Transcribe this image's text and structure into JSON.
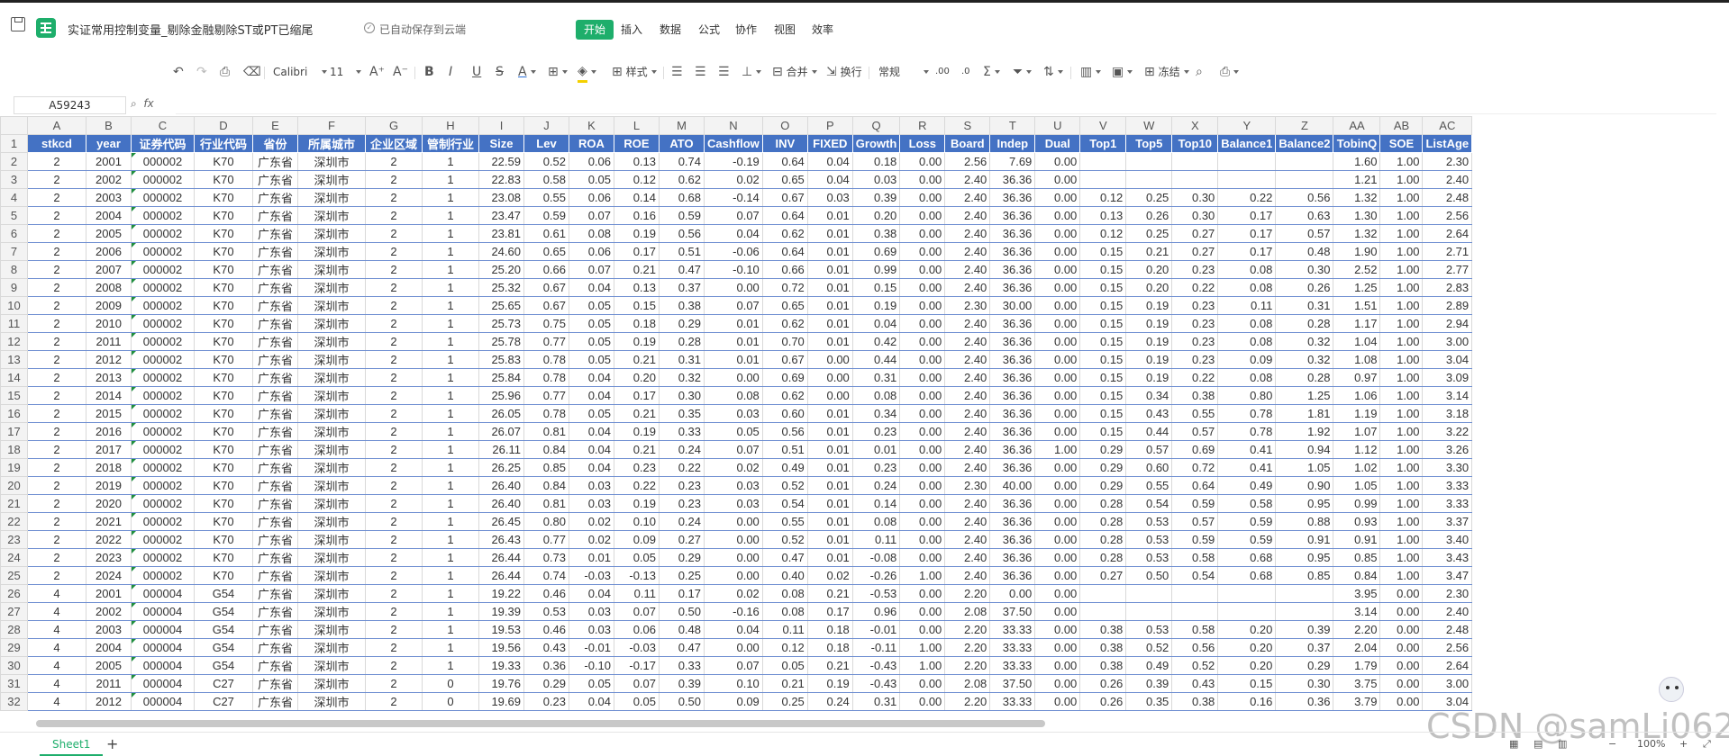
{
  "app": {
    "title": "实证常用控制变量_剔除金融剔除ST或PT已缩尾",
    "cloud_status": "已自动保存到云端"
  },
  "menu": {
    "tabs": [
      {
        "label": "开始",
        "active": true
      },
      {
        "label": "插入",
        "active": false
      },
      {
        "label": "数据",
        "active": false
      },
      {
        "label": "公式",
        "active": false
      },
      {
        "label": "协作",
        "active": false
      },
      {
        "label": "视图",
        "active": false
      },
      {
        "label": "效率",
        "active": false
      }
    ]
  },
  "toolbar": {
    "font_name": "Calibri",
    "font_size": "11",
    "styles_label": "样式",
    "merge_label": "合并",
    "wrap_label": "换行",
    "number_format": "常规",
    "freeze_label": "冻结",
    "bold": "B",
    "italic": "I",
    "underline": "U",
    "strike": "S",
    "font_color_glyph": "A",
    "inc_font": "A⁺",
    "dec_font": "A⁻",
    "dec_inc": ".00",
    "dec_dec": ".0",
    "sum_glyph": "Σ"
  },
  "formula_bar": {
    "cell_ref": "A59243",
    "fx_label": "fx",
    "formula_value": ""
  },
  "sheet": {
    "columns": [
      "A",
      "B",
      "C",
      "D",
      "E",
      "F",
      "G",
      "H",
      "I",
      "J",
      "K",
      "L",
      "M",
      "N",
      "O",
      "P",
      "Q",
      "R",
      "S",
      "T",
      "U",
      "V",
      "W",
      "X",
      "Y",
      "Z",
      "AA",
      "AB",
      "AC"
    ],
    "header_row": [
      "stkcd",
      "year",
      "证券代码",
      "行业代码",
      "省份",
      "所属城市",
      "企业区域",
      "管制行业",
      "Size",
      "Lev",
      "ROA",
      "ROE",
      "ATO",
      "Cashflow",
      "INV",
      "FIXED",
      "Growth",
      "Loss",
      "Board",
      "Indep",
      "Dual",
      "Top1",
      "Top5",
      "Top10",
      "Balance1",
      "Balance2",
      "TobinQ",
      "SOE",
      "ListAge"
    ],
    "rows": [
      [
        "2",
        "2001",
        "000002",
        "K70",
        "广东省",
        "深圳市",
        "2",
        "1",
        "22.59",
        "0.52",
        "0.06",
        "0.13",
        "0.74",
        "-0.19",
        "0.64",
        "0.04",
        "0.18",
        "0.00",
        "2.56",
        "7.69",
        "0.00",
        "",
        "",
        "",
        "",
        "",
        "1.60",
        "1.00",
        "2.30"
      ],
      [
        "2",
        "2002",
        "000002",
        "K70",
        "广东省",
        "深圳市",
        "2",
        "1",
        "22.83",
        "0.58",
        "0.05",
        "0.12",
        "0.62",
        "0.02",
        "0.65",
        "0.04",
        "0.03",
        "0.00",
        "2.40",
        "36.36",
        "0.00",
        "",
        "",
        "",
        "",
        "",
        "1.21",
        "1.00",
        "2.40"
      ],
      [
        "2",
        "2003",
        "000002",
        "K70",
        "广东省",
        "深圳市",
        "2",
        "1",
        "23.08",
        "0.55",
        "0.06",
        "0.14",
        "0.68",
        "-0.14",
        "0.67",
        "0.03",
        "0.39",
        "0.00",
        "2.40",
        "36.36",
        "0.00",
        "0.12",
        "0.25",
        "0.30",
        "0.22",
        "0.56",
        "1.32",
        "1.00",
        "2.48"
      ],
      [
        "2",
        "2004",
        "000002",
        "K70",
        "广东省",
        "深圳市",
        "2",
        "1",
        "23.47",
        "0.59",
        "0.07",
        "0.16",
        "0.59",
        "0.07",
        "0.64",
        "0.01",
        "0.20",
        "0.00",
        "2.40",
        "36.36",
        "0.00",
        "0.13",
        "0.26",
        "0.30",
        "0.17",
        "0.63",
        "1.30",
        "1.00",
        "2.56"
      ],
      [
        "2",
        "2005",
        "000002",
        "K70",
        "广东省",
        "深圳市",
        "2",
        "1",
        "23.81",
        "0.61",
        "0.08",
        "0.19",
        "0.56",
        "0.04",
        "0.62",
        "0.01",
        "0.38",
        "0.00",
        "2.40",
        "36.36",
        "0.00",
        "0.12",
        "0.25",
        "0.27",
        "0.17",
        "0.57",
        "1.32",
        "1.00",
        "2.64"
      ],
      [
        "2",
        "2006",
        "000002",
        "K70",
        "广东省",
        "深圳市",
        "2",
        "1",
        "24.60",
        "0.65",
        "0.06",
        "0.17",
        "0.51",
        "-0.06",
        "0.64",
        "0.01",
        "0.69",
        "0.00",
        "2.40",
        "36.36",
        "0.00",
        "0.15",
        "0.21",
        "0.27",
        "0.17",
        "0.48",
        "1.90",
        "1.00",
        "2.71"
      ],
      [
        "2",
        "2007",
        "000002",
        "K70",
        "广东省",
        "深圳市",
        "2",
        "1",
        "25.20",
        "0.66",
        "0.07",
        "0.21",
        "0.47",
        "-0.10",
        "0.66",
        "0.01",
        "0.99",
        "0.00",
        "2.40",
        "36.36",
        "0.00",
        "0.15",
        "0.20",
        "0.23",
        "0.08",
        "0.30",
        "2.52",
        "1.00",
        "2.77"
      ],
      [
        "2",
        "2008",
        "000002",
        "K70",
        "广东省",
        "深圳市",
        "2",
        "1",
        "25.32",
        "0.67",
        "0.04",
        "0.13",
        "0.37",
        "0.00",
        "0.72",
        "0.01",
        "0.15",
        "0.00",
        "2.40",
        "36.36",
        "0.00",
        "0.15",
        "0.20",
        "0.22",
        "0.08",
        "0.26",
        "1.25",
        "1.00",
        "2.83"
      ],
      [
        "2",
        "2009",
        "000002",
        "K70",
        "广东省",
        "深圳市",
        "2",
        "1",
        "25.65",
        "0.67",
        "0.05",
        "0.15",
        "0.38",
        "0.07",
        "0.65",
        "0.01",
        "0.19",
        "0.00",
        "2.30",
        "30.00",
        "0.00",
        "0.15",
        "0.19",
        "0.23",
        "0.11",
        "0.31",
        "1.51",
        "1.00",
        "2.89"
      ],
      [
        "2",
        "2010",
        "000002",
        "K70",
        "广东省",
        "深圳市",
        "2",
        "1",
        "25.73",
        "0.75",
        "0.05",
        "0.18",
        "0.29",
        "0.01",
        "0.62",
        "0.01",
        "0.04",
        "0.00",
        "2.40",
        "36.36",
        "0.00",
        "0.15",
        "0.19",
        "0.23",
        "0.08",
        "0.28",
        "1.17",
        "1.00",
        "2.94"
      ],
      [
        "2",
        "2011",
        "000002",
        "K70",
        "广东省",
        "深圳市",
        "2",
        "1",
        "25.78",
        "0.77",
        "0.05",
        "0.19",
        "0.28",
        "0.01",
        "0.70",
        "0.01",
        "0.42",
        "0.00",
        "2.40",
        "36.36",
        "0.00",
        "0.15",
        "0.19",
        "0.23",
        "0.08",
        "0.32",
        "1.04",
        "1.00",
        "3.00"
      ],
      [
        "2",
        "2012",
        "000002",
        "K70",
        "广东省",
        "深圳市",
        "2",
        "1",
        "25.83",
        "0.78",
        "0.05",
        "0.21",
        "0.31",
        "0.01",
        "0.67",
        "0.00",
        "0.44",
        "0.00",
        "2.40",
        "36.36",
        "0.00",
        "0.15",
        "0.19",
        "0.23",
        "0.09",
        "0.32",
        "1.08",
        "1.00",
        "3.04"
      ],
      [
        "2",
        "2013",
        "000002",
        "K70",
        "广东省",
        "深圳市",
        "2",
        "1",
        "25.84",
        "0.78",
        "0.04",
        "0.20",
        "0.32",
        "0.00",
        "0.69",
        "0.00",
        "0.31",
        "0.00",
        "2.40",
        "36.36",
        "0.00",
        "0.15",
        "0.19",
        "0.22",
        "0.08",
        "0.28",
        "0.97",
        "1.00",
        "3.09"
      ],
      [
        "2",
        "2014",
        "000002",
        "K70",
        "广东省",
        "深圳市",
        "2",
        "1",
        "25.96",
        "0.77",
        "0.04",
        "0.17",
        "0.30",
        "0.08",
        "0.62",
        "0.00",
        "0.08",
        "0.00",
        "2.40",
        "36.36",
        "0.00",
        "0.15",
        "0.34",
        "0.38",
        "0.80",
        "1.25",
        "1.06",
        "1.00",
        "3.14"
      ],
      [
        "2",
        "2015",
        "000002",
        "K70",
        "广东省",
        "深圳市",
        "2",
        "1",
        "26.05",
        "0.78",
        "0.05",
        "0.21",
        "0.35",
        "0.03",
        "0.60",
        "0.01",
        "0.34",
        "0.00",
        "2.40",
        "36.36",
        "0.00",
        "0.15",
        "0.43",
        "0.55",
        "0.78",
        "1.81",
        "1.19",
        "1.00",
        "3.18"
      ],
      [
        "2",
        "2016",
        "000002",
        "K70",
        "广东省",
        "深圳市",
        "2",
        "1",
        "26.07",
        "0.81",
        "0.04",
        "0.19",
        "0.33",
        "0.05",
        "0.56",
        "0.01",
        "0.23",
        "0.00",
        "2.40",
        "36.36",
        "0.00",
        "0.15",
        "0.44",
        "0.57",
        "0.78",
        "1.92",
        "1.07",
        "1.00",
        "3.22"
      ],
      [
        "2",
        "2017",
        "000002",
        "K70",
        "广东省",
        "深圳市",
        "2",
        "1",
        "26.11",
        "0.84",
        "0.04",
        "0.21",
        "0.24",
        "0.07",
        "0.51",
        "0.01",
        "0.01",
        "0.00",
        "2.40",
        "36.36",
        "1.00",
        "0.29",
        "0.57",
        "0.69",
        "0.41",
        "0.94",
        "1.12",
        "1.00",
        "3.26"
      ],
      [
        "2",
        "2018",
        "000002",
        "K70",
        "广东省",
        "深圳市",
        "2",
        "1",
        "26.25",
        "0.85",
        "0.04",
        "0.23",
        "0.22",
        "0.02",
        "0.49",
        "0.01",
        "0.23",
        "0.00",
        "2.40",
        "36.36",
        "0.00",
        "0.29",
        "0.60",
        "0.72",
        "0.41",
        "1.05",
        "1.02",
        "1.00",
        "3.30"
      ],
      [
        "2",
        "2019",
        "000002",
        "K70",
        "广东省",
        "深圳市",
        "2",
        "1",
        "26.40",
        "0.84",
        "0.03",
        "0.22",
        "0.23",
        "0.03",
        "0.52",
        "0.01",
        "0.24",
        "0.00",
        "2.30",
        "40.00",
        "0.00",
        "0.29",
        "0.55",
        "0.64",
        "0.49",
        "0.90",
        "1.05",
        "1.00",
        "3.33"
      ],
      [
        "2",
        "2020",
        "000002",
        "K70",
        "广东省",
        "深圳市",
        "2",
        "1",
        "26.40",
        "0.81",
        "0.03",
        "0.19",
        "0.23",
        "0.03",
        "0.54",
        "0.01",
        "0.14",
        "0.00",
        "2.40",
        "36.36",
        "0.00",
        "0.28",
        "0.54",
        "0.59",
        "0.58",
        "0.95",
        "0.99",
        "1.00",
        "3.33"
      ],
      [
        "2",
        "2021",
        "000002",
        "K70",
        "广东省",
        "深圳市",
        "2",
        "1",
        "26.45",
        "0.80",
        "0.02",
        "0.10",
        "0.24",
        "0.00",
        "0.55",
        "0.01",
        "0.08",
        "0.00",
        "2.40",
        "36.36",
        "0.00",
        "0.28",
        "0.53",
        "0.57",
        "0.59",
        "0.88",
        "0.93",
        "1.00",
        "3.37"
      ],
      [
        "2",
        "2022",
        "000002",
        "K70",
        "广东省",
        "深圳市",
        "2",
        "1",
        "26.43",
        "0.77",
        "0.02",
        "0.09",
        "0.27",
        "0.00",
        "0.52",
        "0.01",
        "0.11",
        "0.00",
        "2.40",
        "36.36",
        "0.00",
        "0.28",
        "0.53",
        "0.59",
        "0.59",
        "0.91",
        "0.91",
        "1.00",
        "3.40"
      ],
      [
        "2",
        "2023",
        "000002",
        "K70",
        "广东省",
        "深圳市",
        "2",
        "1",
        "26.44",
        "0.73",
        "0.01",
        "0.05",
        "0.29",
        "0.00",
        "0.47",
        "0.01",
        "-0.08",
        "0.00",
        "2.40",
        "36.36",
        "0.00",
        "0.28",
        "0.53",
        "0.58",
        "0.68",
        "0.95",
        "0.85",
        "1.00",
        "3.43"
      ],
      [
        "2",
        "2024",
        "000002",
        "K70",
        "广东省",
        "深圳市",
        "2",
        "1",
        "26.44",
        "0.74",
        "-0.03",
        "-0.13",
        "0.25",
        "0.00",
        "0.40",
        "0.02",
        "-0.26",
        "1.00",
        "2.40",
        "36.36",
        "0.00",
        "0.27",
        "0.50",
        "0.54",
        "0.68",
        "0.85",
        "0.84",
        "1.00",
        "3.47"
      ],
      [
        "4",
        "2001",
        "000004",
        "G54",
        "广东省",
        "深圳市",
        "2",
        "1",
        "19.22",
        "0.46",
        "0.04",
        "0.11",
        "0.17",
        "0.02",
        "0.08",
        "0.21",
        "-0.53",
        "0.00",
        "2.20",
        "0.00",
        "0.00",
        "",
        "",
        "",
        "",
        "",
        "3.95",
        "0.00",
        "2.30"
      ],
      [
        "4",
        "2002",
        "000004",
        "G54",
        "广东省",
        "深圳市",
        "2",
        "1",
        "19.39",
        "0.53",
        "0.03",
        "0.07",
        "0.50",
        "-0.16",
        "0.08",
        "0.17",
        "0.96",
        "0.00",
        "2.08",
        "37.50",
        "0.00",
        "",
        "",
        "",
        "",
        "",
        "3.14",
        "0.00",
        "2.40"
      ],
      [
        "4",
        "2003",
        "000004",
        "G54",
        "广东省",
        "深圳市",
        "2",
        "1",
        "19.53",
        "0.46",
        "0.03",
        "0.06",
        "0.48",
        "0.04",
        "0.11",
        "0.18",
        "-0.01",
        "0.00",
        "2.20",
        "33.33",
        "0.00",
        "0.38",
        "0.53",
        "0.58",
        "0.20",
        "0.39",
        "2.20",
        "0.00",
        "2.48"
      ],
      [
        "4",
        "2004",
        "000004",
        "G54",
        "广东省",
        "深圳市",
        "2",
        "1",
        "19.56",
        "0.43",
        "-0.01",
        "-0.03",
        "0.47",
        "0.00",
        "0.12",
        "0.18",
        "-0.11",
        "1.00",
        "2.20",
        "33.33",
        "0.00",
        "0.38",
        "0.52",
        "0.56",
        "0.20",
        "0.37",
        "2.04",
        "0.00",
        "2.56"
      ],
      [
        "4",
        "2005",
        "000004",
        "G54",
        "广东省",
        "深圳市",
        "2",
        "1",
        "19.33",
        "0.36",
        "-0.10",
        "-0.17",
        "0.33",
        "0.07",
        "0.05",
        "0.21",
        "-0.43",
        "1.00",
        "2.20",
        "33.33",
        "0.00",
        "0.38",
        "0.49",
        "0.52",
        "0.20",
        "0.29",
        "1.79",
        "0.00",
        "2.64"
      ],
      [
        "4",
        "2011",
        "000004",
        "C27",
        "广东省",
        "深圳市",
        "2",
        "0",
        "19.76",
        "0.29",
        "0.05",
        "0.07",
        "0.39",
        "0.10",
        "0.21",
        "0.19",
        "-0.43",
        "0.00",
        "2.08",
        "37.50",
        "0.00",
        "0.26",
        "0.39",
        "0.43",
        "0.15",
        "0.30",
        "3.75",
        "0.00",
        "3.00"
      ],
      [
        "4",
        "2012",
        "000004",
        "C27",
        "广东省",
        "深圳市",
        "2",
        "0",
        "19.69",
        "0.23",
        "0.04",
        "0.05",
        "0.50",
        "0.09",
        "0.25",
        "0.24",
        "0.31",
        "0.00",
        "2.20",
        "33.33",
        "0.00",
        "0.26",
        "0.35",
        "0.38",
        "0.16",
        "0.36",
        "3.79",
        "0.00",
        "3.04"
      ]
    ]
  },
  "bottom": {
    "sheet_tab": "Sheet1",
    "add_sheet": "+",
    "zoom": "100%",
    "watermark": "CSDN @samLi0620"
  }
}
